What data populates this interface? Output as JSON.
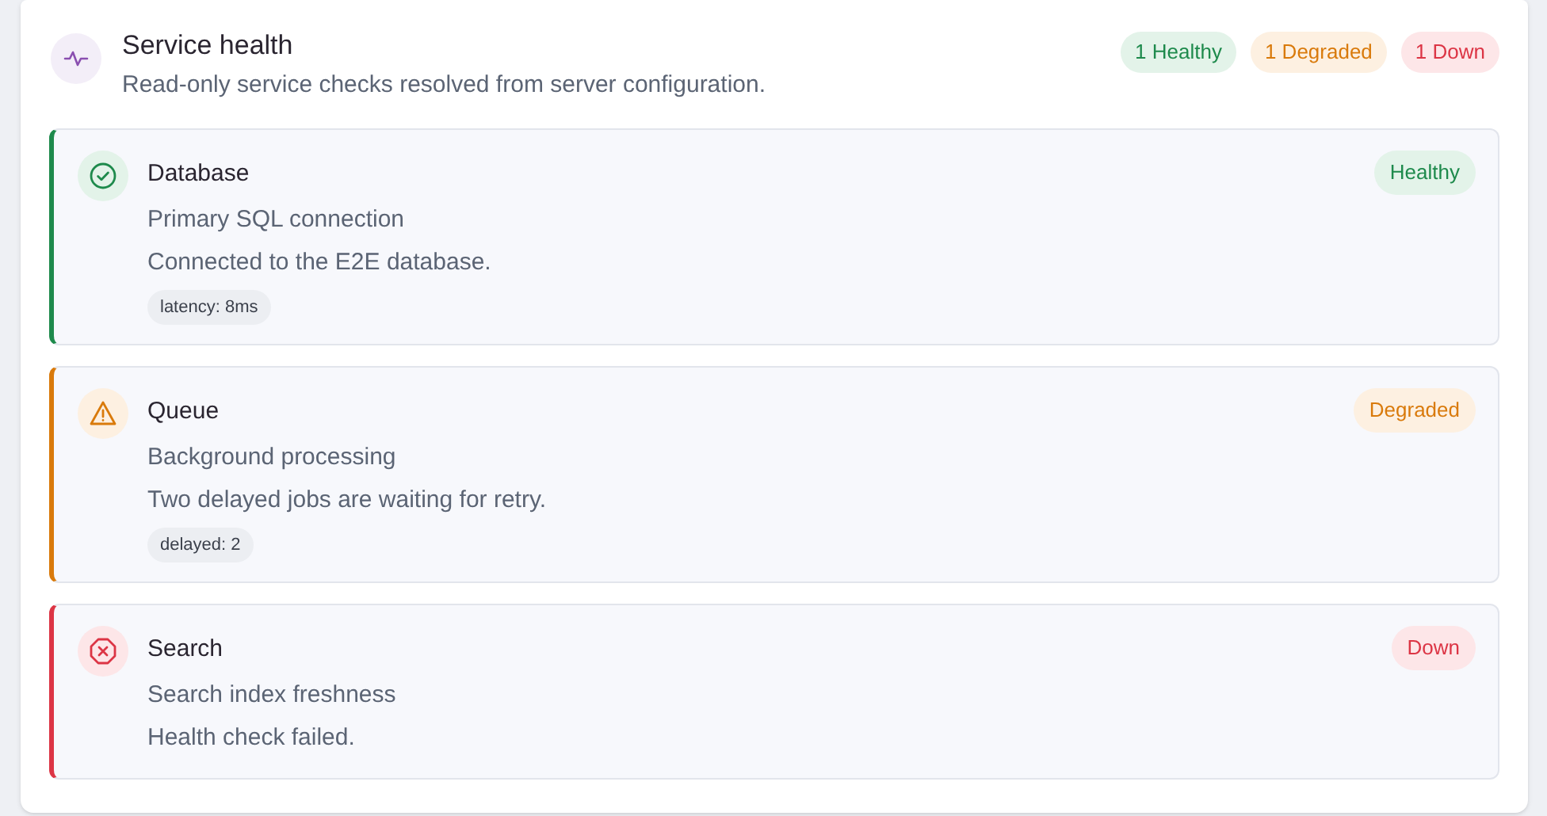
{
  "header": {
    "title": "Service health",
    "subtitle": "Read-only service checks resolved from server configuration."
  },
  "summary": [
    {
      "label": "1 Healthy",
      "kind": "healthy"
    },
    {
      "label": "1 Degraded",
      "kind": "degraded"
    },
    {
      "label": "1 Down",
      "kind": "down"
    }
  ],
  "services": [
    {
      "name": "Database",
      "kind": "healthy",
      "badge": "Healthy",
      "description": "Primary SQL connection",
      "message": "Connected to the E2E database.",
      "metric": "latency: 8ms"
    },
    {
      "name": "Queue",
      "kind": "degraded",
      "badge": "Degraded",
      "description": "Background processing",
      "message": "Two delayed jobs are waiting for retry.",
      "metric": "delayed: 2"
    },
    {
      "name": "Search",
      "kind": "down",
      "badge": "Down",
      "description": "Search index freshness",
      "message": "Health check failed."
    }
  ]
}
